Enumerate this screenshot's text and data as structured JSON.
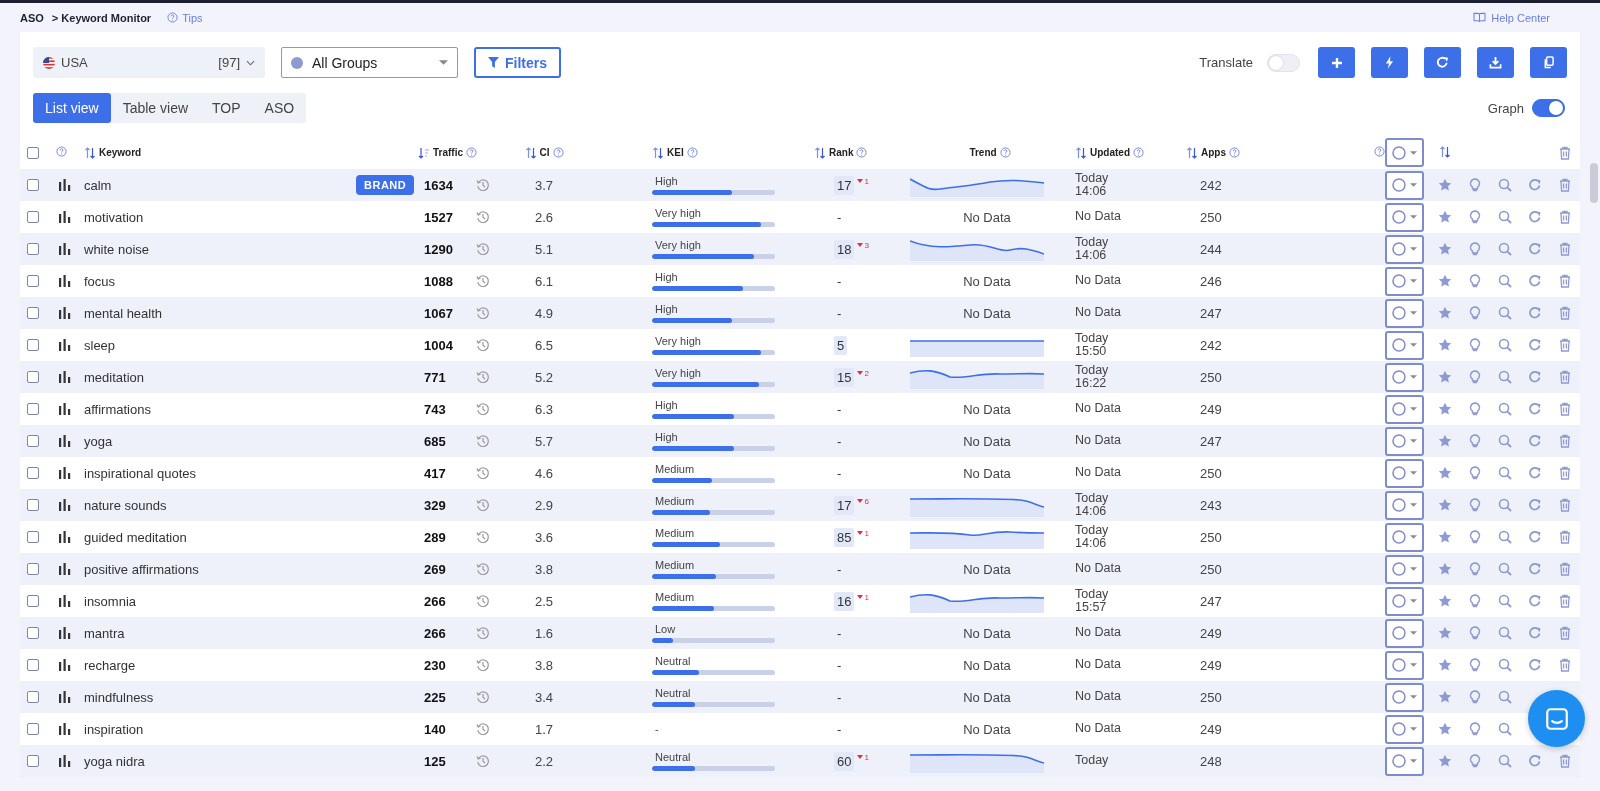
{
  "breadcrumb": {
    "root": "ASO",
    "page": "> Keyword Monitor",
    "tips": "Tips"
  },
  "help_link": "Help Center",
  "toolbar": {
    "country": {
      "name": "USA",
      "count": "[97]"
    },
    "group": {
      "name": "All Groups"
    },
    "filters": "Filters",
    "translate": {
      "label": "Translate",
      "on": false
    }
  },
  "tabs": [
    {
      "label": "List view",
      "selected": true
    },
    {
      "label": "Table view",
      "selected": false
    },
    {
      "label": "TOP",
      "selected": false
    },
    {
      "label": "ASO",
      "selected": false
    }
  ],
  "graph": {
    "label": "Graph",
    "on": true
  },
  "select_all": false,
  "columns": [
    {
      "label": "Keyword",
      "kind": "sortable"
    },
    {
      "label": "Traffic",
      "kind": "sorted"
    },
    {
      "label": "CI",
      "kind": "sortable"
    },
    {
      "label": "KEI",
      "kind": "sortable"
    },
    {
      "label": "Rank",
      "kind": "sortable"
    },
    {
      "label": "Trend",
      "kind": "plain"
    },
    {
      "label": "Updated",
      "kind": "sortable"
    },
    {
      "label": "Apps",
      "kind": "sortable"
    }
  ],
  "rows": [
    {
      "checked": false,
      "keyword": "calm",
      "brand": "BRAND",
      "traffic": "1634",
      "ci": "3.7",
      "kei": {
        "label": "High",
        "level": 0.65
      },
      "rank": "17",
      "ranked": true,
      "rank_change": "1",
      "trend": {
        "kind": "sparkline"
      },
      "updated": "Today 14:06",
      "apps": "242"
    },
    {
      "checked": false,
      "keyword": "motivation",
      "traffic": "1527",
      "ci": "2.6",
      "kei": {
        "label": "Very high",
        "level": 0.89
      },
      "rank": "-",
      "ranked": false,
      "trend": {
        "kind": "text",
        "text": "No Data"
      },
      "updated": "No Data",
      "apps": "250"
    },
    {
      "checked": false,
      "keyword": "white noise",
      "traffic": "1290",
      "ci": "5.1",
      "kei": {
        "label": "Very high",
        "level": 0.83
      },
      "rank": "18",
      "ranked": true,
      "rank_change": "3",
      "trend": {
        "kind": "sparkline"
      },
      "updated": "Today 14:06",
      "apps": "244"
    },
    {
      "checked": false,
      "keyword": "focus",
      "traffic": "1088",
      "ci": "6.1",
      "kei": {
        "label": "High",
        "level": 0.74
      },
      "rank": "-",
      "ranked": false,
      "trend": {
        "kind": "text",
        "text": "No Data"
      },
      "updated": "No Data",
      "apps": "246"
    },
    {
      "checked": false,
      "keyword": "mental health",
      "traffic": "1067",
      "ci": "4.9",
      "kei": {
        "label": "High",
        "level": 0.65
      },
      "rank": "-",
      "ranked": false,
      "trend": {
        "kind": "text",
        "text": "No Data"
      },
      "updated": "No Data",
      "apps": "247"
    },
    {
      "checked": false,
      "keyword": "sleep",
      "traffic": "1004",
      "ci": "6.5",
      "kei": {
        "label": "Very high",
        "level": 0.89
      },
      "rank": "5",
      "ranked": true,
      "trend": {
        "kind": "sparkline"
      },
      "updated": "Today 15:50",
      "apps": "242"
    },
    {
      "checked": false,
      "keyword": "meditation",
      "traffic": "771",
      "ci": "5.2",
      "kei": {
        "label": "Very high",
        "level": 0.87
      },
      "rank": "15",
      "ranked": true,
      "rank_change": "2",
      "trend": {
        "kind": "sparkline"
      },
      "updated": "Today 16:22",
      "apps": "250"
    },
    {
      "checked": false,
      "keyword": "affirmations",
      "traffic": "743",
      "ci": "6.3",
      "kei": {
        "label": "High",
        "level": 0.67
      },
      "rank": "-",
      "ranked": false,
      "trend": {
        "kind": "text",
        "text": "No Data"
      },
      "updated": "No Data",
      "apps": "249"
    },
    {
      "checked": false,
      "keyword": "yoga",
      "traffic": "685",
      "ci": "5.7",
      "kei": {
        "label": "High",
        "level": 0.67
      },
      "rank": "-",
      "ranked": false,
      "trend": {
        "kind": "text",
        "text": "No Data"
      },
      "updated": "No Data",
      "apps": "247"
    },
    {
      "checked": false,
      "keyword": "inspirational quotes",
      "traffic": "417",
      "ci": "4.6",
      "kei": {
        "label": "Medium",
        "level": 0.49
      },
      "rank": "-",
      "ranked": false,
      "trend": {
        "kind": "text",
        "text": "No Data"
      },
      "updated": "No Data",
      "apps": "250"
    },
    {
      "checked": false,
      "keyword": "nature sounds",
      "traffic": "329",
      "ci": "2.9",
      "kei": {
        "label": "Medium",
        "level": 0.47
      },
      "rank": "17",
      "ranked": true,
      "rank_change": "6",
      "trend": {
        "kind": "sparkline"
      },
      "updated": "Today 14:06",
      "apps": "243"
    },
    {
      "checked": false,
      "keyword": "guided meditation",
      "traffic": "289",
      "ci": "3.6",
      "kei": {
        "label": "Medium",
        "level": 0.55
      },
      "rank": "85",
      "ranked": true,
      "rank_change": "1",
      "trend": {
        "kind": "sparkline"
      },
      "updated": "Today 14:06",
      "apps": "250"
    },
    {
      "checked": false,
      "keyword": "positive affirmations",
      "traffic": "269",
      "ci": "3.8",
      "kei": {
        "label": "Medium",
        "level": 0.52
      },
      "rank": "-",
      "ranked": false,
      "trend": {
        "kind": "text",
        "text": "No Data"
      },
      "updated": "No Data",
      "apps": "250"
    },
    {
      "checked": false,
      "keyword": "insomnia",
      "traffic": "266",
      "ci": "2.5",
      "kei": {
        "label": "Medium",
        "level": 0.5
      },
      "rank": "16",
      "ranked": true,
      "rank_change": "1",
      "trend": {
        "kind": "sparkline"
      },
      "updated": "Today 15:57",
      "apps": "247"
    },
    {
      "checked": false,
      "keyword": "mantra",
      "traffic": "266",
      "ci": "1.6",
      "kei": {
        "label": "Low",
        "level": 0.17
      },
      "rank": "-",
      "ranked": false,
      "trend": {
        "kind": "text",
        "text": "No Data"
      },
      "updated": "No Data",
      "apps": "249"
    },
    {
      "checked": false,
      "keyword": "recharge",
      "traffic": "230",
      "ci": "3.8",
      "kei": {
        "label": "Neutral",
        "level": 0.38
      },
      "rank": "-",
      "ranked": false,
      "trend": {
        "kind": "text",
        "text": "No Data"
      },
      "updated": "No Data",
      "apps": "249"
    },
    {
      "checked": false,
      "keyword": "mindfulness",
      "traffic": "225",
      "ci": "3.4",
      "kei": {
        "label": "Neutral",
        "level": 0.35
      },
      "rank": "-",
      "ranked": false,
      "trend": {
        "kind": "text",
        "text": "No Data"
      },
      "updated": "No Data",
      "apps": "250"
    },
    {
      "checked": false,
      "keyword": "inspiration",
      "traffic": "140",
      "ci": "1.7",
      "kei": {
        "label": "-"
      },
      "rank": "-",
      "ranked": false,
      "trend": {
        "kind": "text",
        "text": "No Data"
      },
      "updated": "No Data",
      "apps": "249"
    },
    {
      "checked": false,
      "keyword": "yoga nidra",
      "traffic": "125",
      "ci": "2.2",
      "kei": {
        "label": "Neutral",
        "level": 0.35
      },
      "rank": "60",
      "ranked": true,
      "rank_change": "1",
      "trend": {
        "kind": "sparkline"
      },
      "updated": "Today",
      "apps": "248"
    }
  ]
}
